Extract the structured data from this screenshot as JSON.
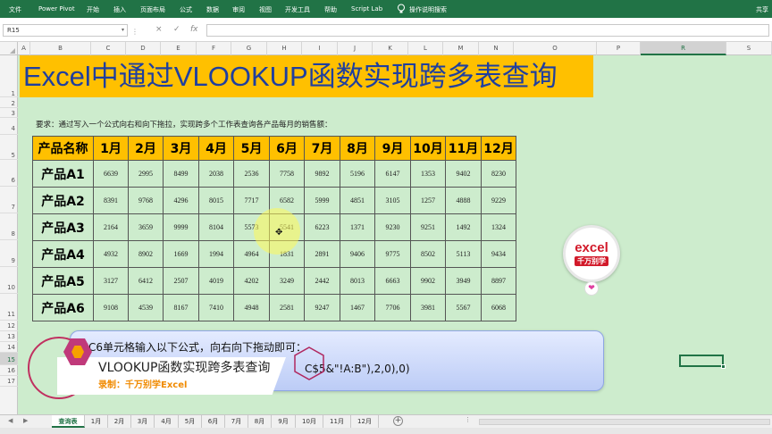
{
  "ribbon": {
    "tabs": [
      "文件",
      "Power Pivot",
      "开始",
      "插入",
      "页面布局",
      "公式",
      "数据",
      "审阅",
      "视图",
      "开发工具",
      "帮助",
      "Script Lab",
      "操作说明搜索",
      "共享"
    ]
  },
  "formula_bar": {
    "name_box": "R15",
    "cancel_glyph": "×",
    "enter_glyph": "✓",
    "fx_glyph": "fx",
    "value": ""
  },
  "columns": [
    "A",
    "B",
    "C",
    "D",
    "E",
    "F",
    "G",
    "H",
    "I",
    "J",
    "K",
    "L",
    "M",
    "N",
    "O",
    "P",
    "R",
    "S"
  ],
  "selected_column": "R",
  "rows": [
    "1",
    "2",
    "3",
    "4",
    "5",
    "6",
    "7",
    "8",
    "9",
    "10",
    "11",
    "12",
    "13",
    "14",
    "15",
    "16",
    "17"
  ],
  "sheet": {
    "banner_title": "Excel中通过VLOOKUP函数实现跨多表查询",
    "requirement": "要求：通过写入一个公式向右和向下拖拉，实现跨多个工作表查询各产品每月的销售额：",
    "table": {
      "headers": [
        "产品名称",
        "1月",
        "2月",
        "3月",
        "4月",
        "5月",
        "6月",
        "7月",
        "8月",
        "9月",
        "10月",
        "11月",
        "12月"
      ],
      "rows": [
        [
          "产品A1",
          "6639",
          "2995",
          "8499",
          "2038",
          "2536",
          "7758",
          "9892",
          "5196",
          "6147",
          "1353",
          "9402",
          "8230"
        ],
        [
          "产品A2",
          "8391",
          "9768",
          "4296",
          "8015",
          "7717",
          "6582",
          "5999",
          "4851",
          "3105",
          "1257",
          "4888",
          "9229"
        ],
        [
          "产品A3",
          "2164",
          "3659",
          "9999",
          "8104",
          "5573",
          "5541",
          "6223",
          "1371",
          "9230",
          "9251",
          "1492",
          "1324"
        ],
        [
          "产品A4",
          "4932",
          "8902",
          "1669",
          "1994",
          "4964",
          "1831",
          "2891",
          "9406",
          "9775",
          "8502",
          "5113",
          "9434"
        ],
        [
          "产品A5",
          "3127",
          "6412",
          "2507",
          "4019",
          "4202",
          "3249",
          "2442",
          "8013",
          "6663",
          "9902",
          "3949",
          "8897"
        ],
        [
          "产品A6",
          "9108",
          "4539",
          "8167",
          "7410",
          "4948",
          "2581",
          "9247",
          "1467",
          "7706",
          "3981",
          "5567",
          "6068"
        ]
      ]
    },
    "callout_line1": "在C6单元格输入以下公式，向右向下拖动即可：",
    "callout_line2": "C$5&\"!A:B\"),2,0),0)",
    "badge_text": "excel",
    "badge_sub": "千万别学",
    "heart_glyph": "❤"
  },
  "overlay": {
    "title": "VLOOKUP函数实现跨多表查询",
    "recorder": "录制：千万别学Excel"
  },
  "sheet_tabs": [
    "查询表",
    "1月",
    "2月",
    "3月",
    "4月",
    "5月",
    "6月",
    "7月",
    "8月",
    "9月",
    "10月",
    "11月",
    "12月"
  ],
  "active_sheet": "查询表",
  "tab_nav": {
    "prev": "◀",
    "next": "▶",
    "add": "+",
    "more": "⋮"
  },
  "colors": {
    "excel_green": "#217346",
    "banner": "#ffc000",
    "sheet_bg": "#cdeccd",
    "title_blue": "#1f3f9f"
  }
}
